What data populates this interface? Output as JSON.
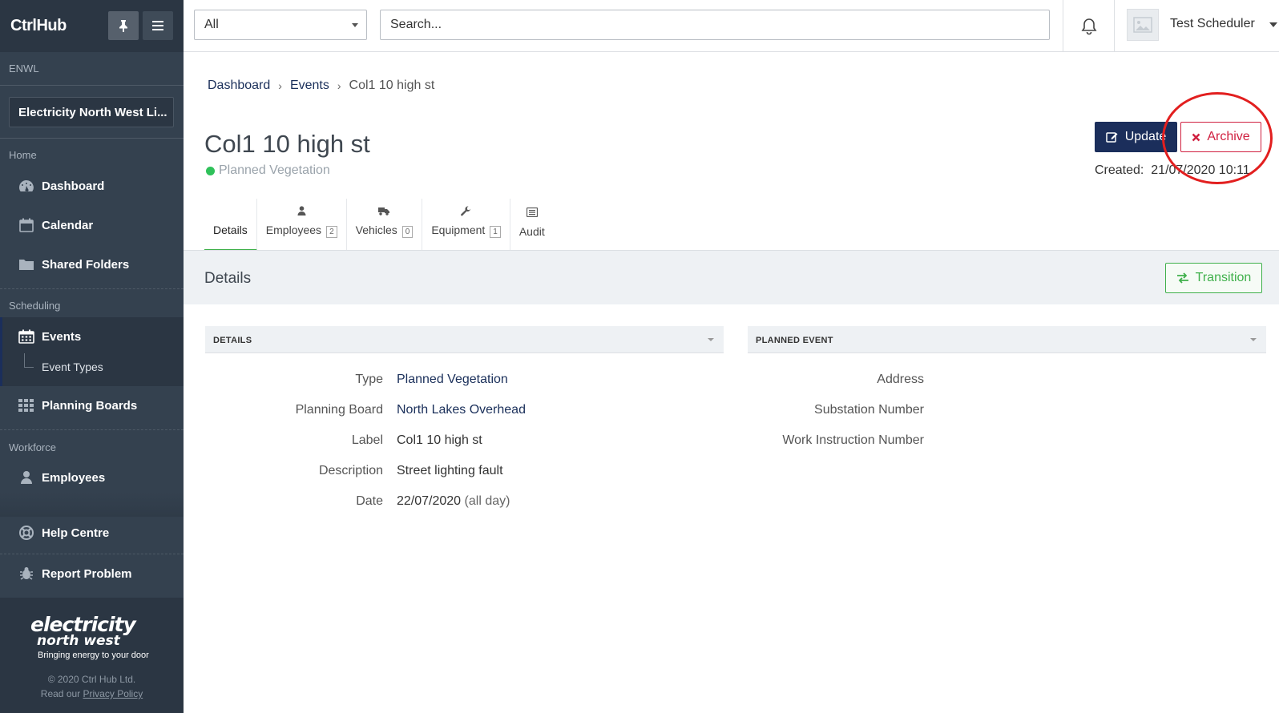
{
  "app": {
    "brand": "CtrlHub"
  },
  "sidebar": {
    "org_label": "ENWL",
    "org_name": "Electricity North West Li...",
    "sections": {
      "home": "Home",
      "scheduling": "Scheduling",
      "workforce": "Workforce"
    },
    "items": {
      "dashboard": "Dashboard",
      "calendar": "Calendar",
      "shared_folders": "Shared Folders",
      "events": "Events",
      "event_types": "Event Types",
      "planning_boards": "Planning Boards",
      "employees": "Employees",
      "help_centre": "Help Centre",
      "report_problem": "Report Problem"
    },
    "footer": {
      "logo_line1": "electricity",
      "logo_line2": "north west",
      "tagline": "Bringing energy to your door",
      "copyright": "© 2020 Ctrl Hub Ltd.",
      "privacy_prefix": "Read our",
      "privacy_link": "Privacy Policy"
    }
  },
  "topbar": {
    "filter_value": "All",
    "search_placeholder": "Search...",
    "user_name": "Test Scheduler"
  },
  "breadcrumb": [
    "Dashboard",
    "Events",
    "Col1 10 high st"
  ],
  "page": {
    "title": "Col1 10 high st",
    "status": "Planned Vegetation",
    "status_color": "#2fc15a",
    "update_label": "Update",
    "archive_label": "Archive",
    "created_label": "Created:",
    "created_value": "21/07/2020 10:11"
  },
  "tabs": [
    {
      "label": "Details",
      "icon": "none",
      "count": null
    },
    {
      "label": "Employees",
      "icon": "user-icon",
      "count": "2"
    },
    {
      "label": "Vehicles",
      "icon": "truck-icon",
      "count": "0"
    },
    {
      "label": "Equipment",
      "icon": "wrench-icon",
      "count": "1"
    },
    {
      "label": "Audit",
      "icon": "list-icon",
      "count": null
    }
  ],
  "details_section": {
    "heading": "Details",
    "transition_label": "Transition"
  },
  "panels": {
    "details": {
      "header": "DETAILS",
      "fields": [
        {
          "label": "Type",
          "value": "Planned Vegetation"
        },
        {
          "label": "Planning Board",
          "value": "North Lakes Overhead"
        },
        {
          "label": "Label",
          "value": "Col1 10 high st"
        },
        {
          "label": "Description",
          "value": "Street lighting fault"
        },
        {
          "label": "Date",
          "value": "22/07/2020",
          "suffix": "(all day)"
        }
      ]
    },
    "planned_event": {
      "header": "PLANNED EVENT",
      "fields": [
        {
          "label": "Address"
        },
        {
          "label": "Substation Number"
        },
        {
          "label": "Work Instruction Number"
        }
      ]
    }
  },
  "colors": {
    "sidebar_bg": "#34414f",
    "sidebar_dark": "#2b3643",
    "primary": "#1b2e5b",
    "danger": "#d02040",
    "success": "#3fb04b",
    "annotation": "#e21f1f"
  }
}
